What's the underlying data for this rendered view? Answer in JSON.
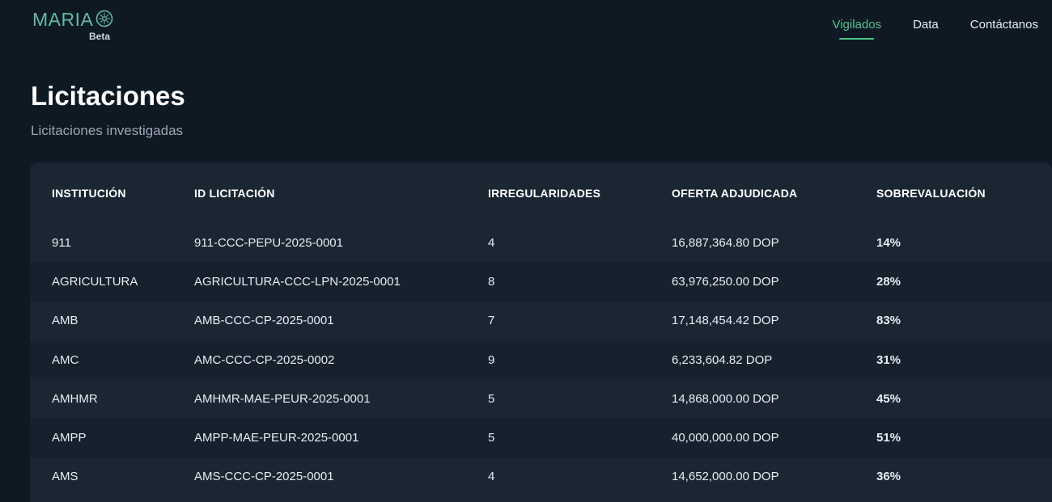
{
  "brand": {
    "name": "MARIA",
    "badge": "Beta",
    "accent": "#5fb8a8"
  },
  "nav": {
    "items": [
      {
        "label": "Vigilados",
        "active": true
      },
      {
        "label": "Data",
        "active": false
      },
      {
        "label": "Contáctanos",
        "active": false
      }
    ],
    "active_color": "#4cc38a"
  },
  "page": {
    "title": "Licitaciones",
    "subtitle": "Licitaciones investigadas"
  },
  "table": {
    "columns": [
      "INSTITUCIÓN",
      "ID LICITACIÓN",
      "IRREGULARIDADES",
      "OFERTA ADJUDICADA",
      "SOBREVALUACIÓN"
    ],
    "rows": [
      {
        "institucion": "911",
        "id": "911-CCC-PEPU-2025-0001",
        "irregularidades": "4",
        "oferta": "16,887,364.80 DOP",
        "sobrevaluacion": "14%"
      },
      {
        "institucion": "AGRICULTURA",
        "id": "AGRICULTURA-CCC-LPN-2025-0001",
        "irregularidades": "8",
        "oferta": "63,976,250.00 DOP",
        "sobrevaluacion": "28%"
      },
      {
        "institucion": "AMB",
        "id": "AMB-CCC-CP-2025-0001",
        "irregularidades": "7",
        "oferta": "17,148,454.42 DOP",
        "sobrevaluacion": "83%"
      },
      {
        "institucion": "AMC",
        "id": "AMC-CCC-CP-2025-0002",
        "irregularidades": "9",
        "oferta": "6,233,604.82 DOP",
        "sobrevaluacion": "31%"
      },
      {
        "institucion": "AMHMR",
        "id": "AMHMR-MAE-PEUR-2025-0001",
        "irregularidades": "5",
        "oferta": "14,868,000.00 DOP",
        "sobrevaluacion": "45%"
      },
      {
        "institucion": "AMPP",
        "id": "AMPP-MAE-PEUR-2025-0001",
        "irregularidades": "5",
        "oferta": "40,000,000.00 DOP",
        "sobrevaluacion": "51%"
      },
      {
        "institucion": "AMS",
        "id": "AMS-CCC-CP-2025-0001",
        "irregularidades": "4",
        "oferta": "14,652,000.00 DOP",
        "sobrevaluacion": "36%"
      }
    ]
  }
}
